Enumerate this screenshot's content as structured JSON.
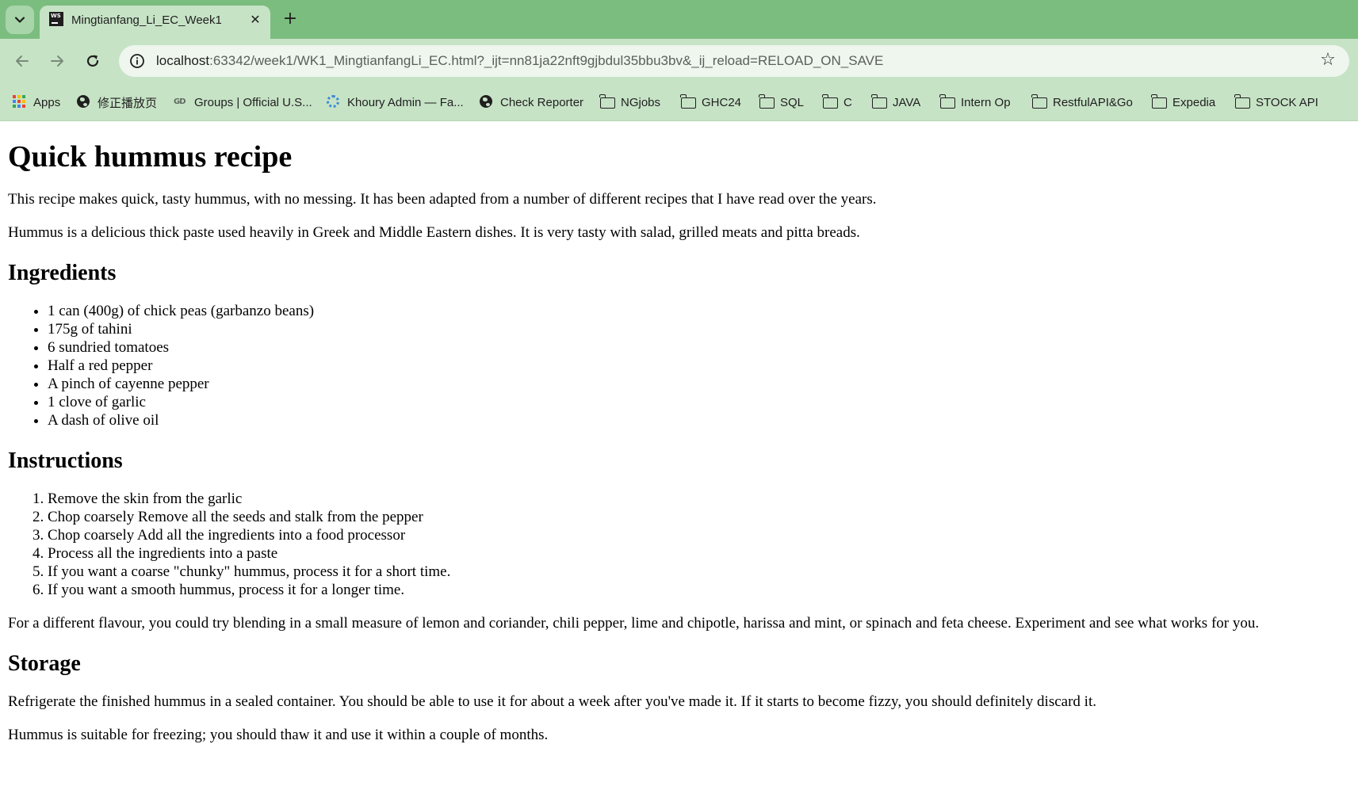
{
  "browser": {
    "tab": {
      "title": "Mingtianfang_Li_EC_Week1",
      "favicon_text": "WS"
    },
    "address": {
      "host": "localhost",
      "rest": ":63342/week1/WK1_MingtianfangLi_EC.html?_ijt=nn81ja22nft9gjbdul35bbu3bv&_ij_reload=RELOAD_ON_SAVE"
    },
    "bookmarks": [
      {
        "label": "Apps",
        "icon": "apps-grid-icon"
      },
      {
        "label": "修正播放页",
        "icon": "globe-icon"
      },
      {
        "label": "Groups | Official U.S...",
        "icon": "gd-logo-icon"
      },
      {
        "label": "Khoury Admin — Fa...",
        "icon": "khoury-icon"
      },
      {
        "label": "Check Reporter",
        "icon": "globe-icon"
      },
      {
        "label": "NGjobs",
        "icon": "folder-icon"
      },
      {
        "label": "GHC24",
        "icon": "folder-icon"
      },
      {
        "label": "SQL",
        "icon": "folder-icon"
      },
      {
        "label": "C",
        "icon": "folder-icon"
      },
      {
        "label": "JAVA",
        "icon": "folder-icon"
      },
      {
        "label": "Intern Op",
        "icon": "folder-icon"
      },
      {
        "label": "RestfulAPI&Go",
        "icon": "folder-icon"
      },
      {
        "label": "Expedia",
        "icon": "folder-icon"
      },
      {
        "label": "STOCK API",
        "icon": "folder-icon"
      }
    ],
    "colors": {
      "tabstrip": "#7bbd7f",
      "toolbar": "#c7e3c6",
      "omnibox": "#eef6ee"
    }
  },
  "page": {
    "title": "Quick hummus recipe",
    "intro": [
      "This recipe makes quick, tasty hummus, with no messing. It has been adapted from a number of different recipes that I have read over the years.",
      "Hummus is a delicious thick paste used heavily in Greek and Middle Eastern dishes. It is very tasty with salad, grilled meats and pitta breads."
    ],
    "ingredients": {
      "heading": "Ingredients",
      "items": [
        "1 can (400g) of chick peas (garbanzo beans)",
        "175g of tahini",
        "6 sundried tomatoes",
        "Half a red pepper",
        "A pinch of cayenne pepper",
        "1 clove of garlic",
        "A dash of olive oil"
      ]
    },
    "instructions": {
      "heading": "Instructions",
      "steps": [
        "Remove the skin from the garlic",
        "Chop coarsely Remove all the seeds and stalk from the pepper",
        "Chop coarsely Add all the ingredients into a food processor",
        "Process all the ingredients into a paste",
        "If you want a coarse \"chunky\" hummus, process it for a short time.",
        "If you want a smooth hummus, process it for a longer time."
      ],
      "note": "For a different flavour, you could try blending in a small measure of lemon and coriander, chili pepper, lime and chipotle, harissa and mint, or spinach and feta cheese. Experiment and see what works for you."
    },
    "storage": {
      "heading": "Storage",
      "paragraphs": [
        "Refrigerate the finished hummus in a sealed container. You should be able to use it for about a week after you've made it. If it starts to become fizzy, you should definitely discard it.",
        "Hummus is suitable for freezing; you should thaw it and use it within a couple of months."
      ]
    }
  }
}
